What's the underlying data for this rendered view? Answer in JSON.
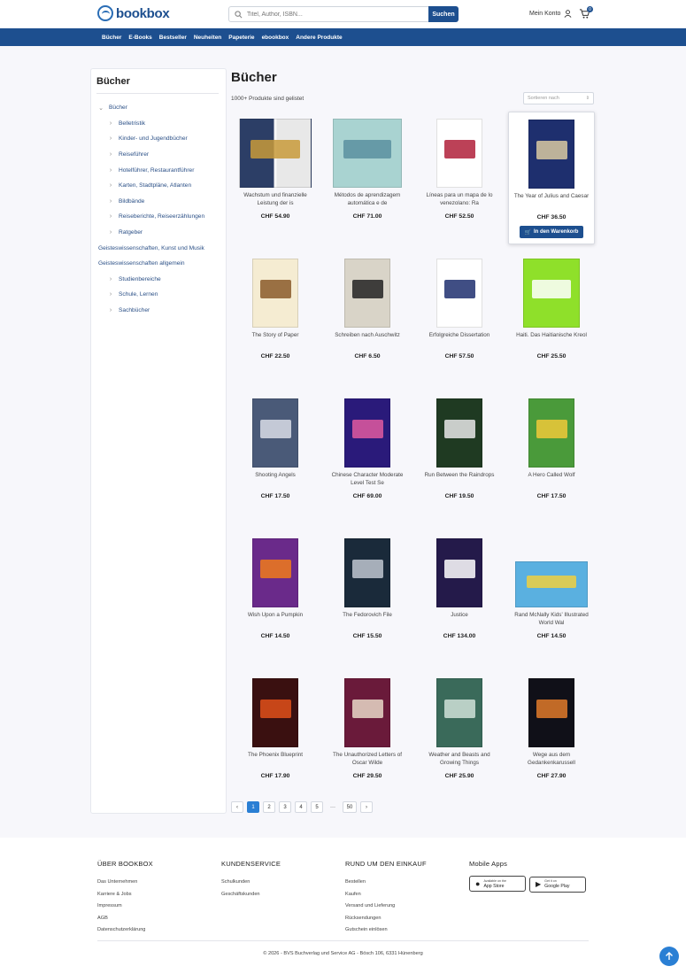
{
  "header": {
    "logo_text": "bookbox",
    "search_placeholder": "Titel, Author, ISBN...",
    "search_button": "Suchen",
    "account_label": "Mein Konto",
    "cart_count": "0"
  },
  "nav": [
    "Bücher",
    "E-Books",
    "Bestseller",
    "Neuheiten",
    "Papeterie",
    "ebookbox",
    "Andere Produkte"
  ],
  "sidebar": {
    "title": "Bücher",
    "items": [
      {
        "label": "Bücher",
        "level": 1,
        "icon": "chevron-down-icon"
      },
      {
        "label": "Belletristik",
        "level": 2,
        "icon": "chevron-right-icon"
      },
      {
        "label": "Kinder- und Jugendbücher",
        "level": 2,
        "icon": "chevron-right-icon"
      },
      {
        "label": "Reiseführer",
        "level": 2,
        "icon": "chevron-right-icon"
      },
      {
        "label": "Hotelführer, Restaurantführer",
        "level": 2,
        "icon": "chevron-right-icon"
      },
      {
        "label": "Karten, Stadtpläne, Atlanten",
        "level": 2,
        "icon": "chevron-right-icon"
      },
      {
        "label": "Bildbände",
        "level": 2,
        "icon": "chevron-right-icon"
      },
      {
        "label": "Reiseberichte, Reiseerzählungen",
        "level": 2,
        "icon": "chevron-right-icon"
      },
      {
        "label": "Ratgeber",
        "level": 2,
        "icon": "chevron-right-icon"
      },
      {
        "label": "Geisteswissenschaften, Kunst und Musik",
        "level": 1,
        "icon": ""
      },
      {
        "label": "Geisteswissenschaften allgemein",
        "level": 1,
        "icon": ""
      },
      {
        "label": "Studienbereiche",
        "level": 2,
        "icon": "chevron-right-icon"
      },
      {
        "label": "Schule, Lernen",
        "level": 2,
        "icon": "chevron-right-icon"
      },
      {
        "label": "Sachbücher",
        "level": 2,
        "icon": "chevron-right-icon"
      }
    ]
  },
  "main": {
    "title": "Bücher",
    "count_text": "1000+ Produkte sind gelistet",
    "sort_placeholder": "Sortieren nach",
    "add_to_cart": "In den Warenkorb"
  },
  "products": [
    {
      "name": "Wachstum und finanzielle Leistung der is",
      "price": "CHF 54.90",
      "cover": "#2c3e66",
      "cover2": "#e8e8e8",
      "accent": "#c89a3a"
    },
    {
      "name": "Métodos de aprendizagem automática e de",
      "price": "CHF 71.00",
      "cover": "#a9d3d1",
      "cover2": "",
      "accent": "#5a8fa0"
    },
    {
      "name": "Líneas para un mapa de lo venezolano: Ra",
      "price": "CHF 52.50",
      "cover": "#ffffff",
      "cover2": "",
      "accent": "#b0203a"
    },
    {
      "name": "The Year of Julius and Caesar",
      "price": "CHF 36.50",
      "cover": "#1e2f6e",
      "cover2": "",
      "accent": "#d9c9a2",
      "highlight": true
    },
    {
      "name": "The Story of Paper",
      "price": "CHF 22.50",
      "cover": "#f5ecd2",
      "cover2": "",
      "accent": "#8a5a2a"
    },
    {
      "name": "Schreiben nach Auschwitz",
      "price": "CHF 6.50",
      "cover": "#d9d4c8",
      "cover2": "",
      "accent": "#222222"
    },
    {
      "name": "Erfolgreiche Dissertation",
      "price": "CHF 57.50",
      "cover": "#ffffff",
      "cover2": "",
      "accent": "#1e2f6e"
    },
    {
      "name": "Haiti. Das Haitianische Kreol",
      "price": "CHF 25.50",
      "cover": "#8fe02a",
      "cover2": "",
      "accent": "#ffffff"
    },
    {
      "name": "Shooting Angels",
      "price": "CHF 17.50",
      "cover": "#4a5a78",
      "cover2": "",
      "accent": "#d9dde6"
    },
    {
      "name": "Chinese Character Moderate Level Test Se",
      "price": "CHF 69.00",
      "cover": "#2a1a7a",
      "cover2": "",
      "accent": "#e05aa0"
    },
    {
      "name": "Run Between the Raindrops",
      "price": "CHF 19.50",
      "cover": "#1f3a22",
      "cover2": "",
      "accent": "#e8e8e8"
    },
    {
      "name": "A Hero Called Wolf",
      "price": "CHF 17.50",
      "cover": "#4a9a3a",
      "cover2": "",
      "accent": "#f0c93a"
    },
    {
      "name": "Wish Upon a Pumpkin",
      "price": "CHF 14.50",
      "cover": "#6a2a8a",
      "cover2": "",
      "accent": "#f07a1a"
    },
    {
      "name": "The Fedorovich File",
      "price": "CHF 15.50",
      "cover": "#1a2a3a",
      "cover2": "",
      "accent": "#c0c6d0"
    },
    {
      "name": "Justice",
      "price": "CHF 134.00",
      "cover": "#241a4a",
      "cover2": "",
      "accent": "#ffffff"
    },
    {
      "name": "Rand McNally Kids' Illustrated World Wal",
      "price": "CHF 14.50",
      "cover": "#5ab0e0",
      "cover2": "",
      "accent": "#f0d040"
    },
    {
      "name": "The Phoenix Blueprint",
      "price": "CHF 17.90",
      "cover": "#3a1010",
      "cover2": "",
      "accent": "#e0501a"
    },
    {
      "name": "The Unauthorized Letters of Oscar Wilde",
      "price": "CHF 29.50",
      "cover": "#6a1a3a",
      "cover2": "",
      "accent": "#e8d8c8"
    },
    {
      "name": "Weather and Beasts and Growing Things",
      "price": "CHF 25.90",
      "cover": "#3a6a5a",
      "cover2": "",
      "accent": "#d0e0d8"
    },
    {
      "name": "Wege aus dem Gedankenkarussell",
      "price": "CHF 27.90",
      "cover": "#101018",
      "cover2": "",
      "accent": "#e07a2a"
    }
  ],
  "pagination": [
    "‹",
    "1",
    "2",
    "3",
    "4",
    "5",
    "···",
    "50",
    "›"
  ],
  "footer": {
    "columns": [
      {
        "title": "ÜBER BOOKBOX",
        "links": [
          "Das Unternehmen",
          "Karriere & Jobs",
          "Impressum",
          "AGB",
          "Datenschutzerklärung"
        ]
      },
      {
        "title": "KUNDENSERVICE",
        "links": [
          "Schulkunden",
          "Geschäftskunden"
        ]
      },
      {
        "title": "RUND UM DEN EINKAUF",
        "links": [
          "Bestellen",
          "Kaufen",
          "Versand und Lieferung",
          "Rücksendungen",
          "Gutschein einlösen"
        ]
      }
    ],
    "apps_title": "Mobile Apps",
    "appstore_small": "Available on the",
    "appstore_big": "App Store",
    "play_small": "Get it on",
    "play_big": "Google Play",
    "copyright": "© 2026 - BVS Buchverlag und Service AG - Bösch 106, 6331 Hünenberg"
  },
  "colors": {
    "brand": "#1d4f8f",
    "accent": "#2a7fd4"
  }
}
